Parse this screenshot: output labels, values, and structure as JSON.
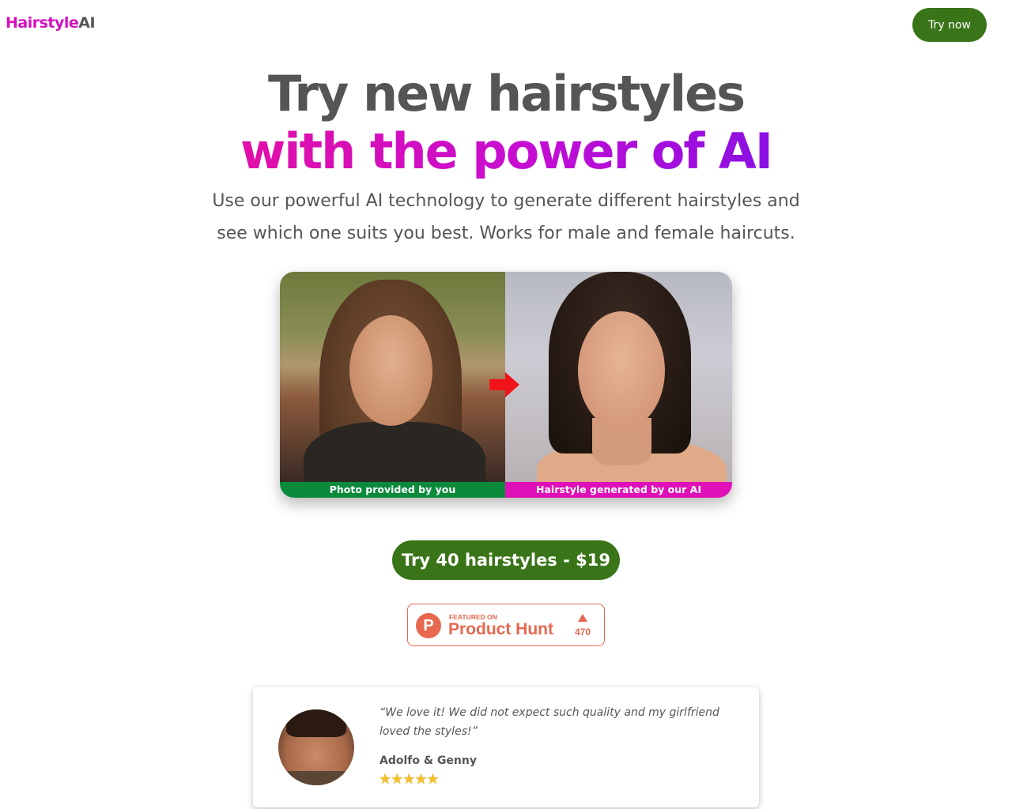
{
  "header": {
    "logo_part1": "Hairstyle",
    "logo_part2": "AI",
    "try_now_label": "Try now"
  },
  "hero": {
    "title_line1": "Try new hairstyles",
    "title_line2": "with the power of AI",
    "subtitle": "Use our powerful AI technology to generate different hairstyles and see which one suits you best. Works for male and female haircuts."
  },
  "comparison": {
    "left_label": "Photo provided by you",
    "right_label": "Hairstyle generated by our AI"
  },
  "cta": {
    "label": "Try 40 hairstyles - $19"
  },
  "product_hunt": {
    "featured_text": "FEATURED ON",
    "name": "Product Hunt",
    "logo_letter": "P",
    "upvotes": "470"
  },
  "testimonial": {
    "quote": "“We love it! We did not expect such quality and my girlfriend loved the styles!”",
    "author": "Adolfo & Genny",
    "stars": "★★★★★"
  },
  "colors": {
    "brand_green": "#3a7418",
    "brand_pink": "#d40fbe",
    "product_hunt_orange": "#e7684f"
  }
}
